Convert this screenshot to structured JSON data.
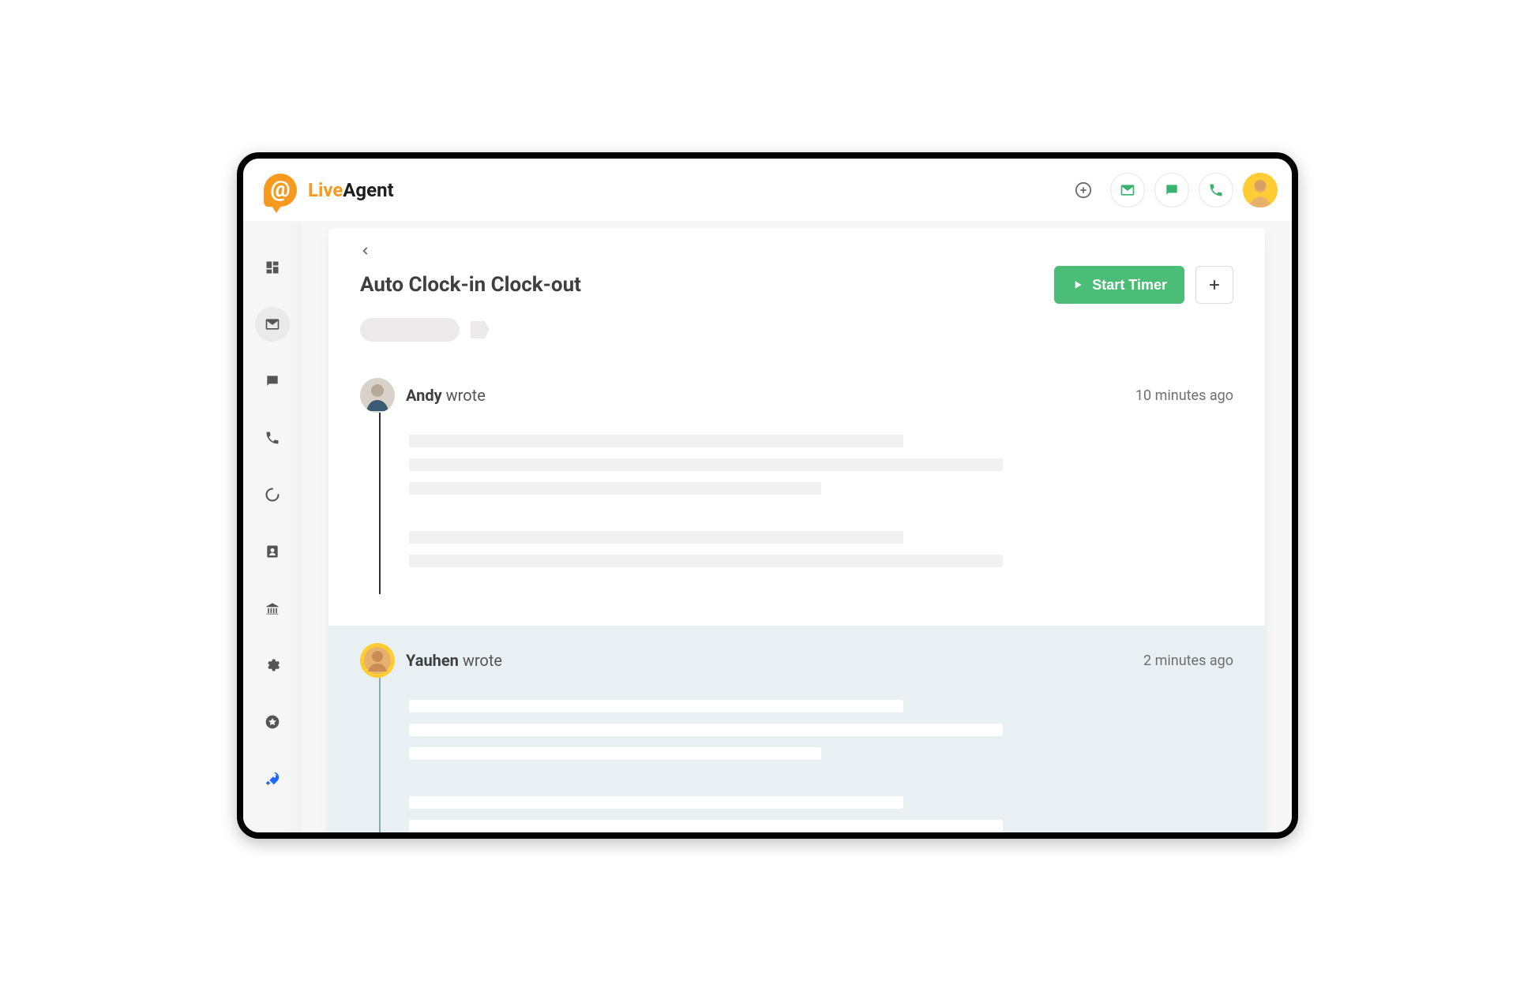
{
  "brand": {
    "part1": "Live",
    "part2": "Agent",
    "glyph": "@"
  },
  "topbar": {
    "add_icon": "plus-circle",
    "mail_icon": "mail",
    "chat_icon": "chat",
    "phone_icon": "phone"
  },
  "sidebar": {
    "items": [
      {
        "key": "dashboard",
        "icon": "dashboard",
        "active": false
      },
      {
        "key": "mail",
        "icon": "mail",
        "active": true
      },
      {
        "key": "chat",
        "icon": "chat",
        "active": false
      },
      {
        "key": "phone",
        "icon": "phone",
        "active": false
      },
      {
        "key": "loading",
        "icon": "spinner",
        "active": false
      },
      {
        "key": "contacts",
        "icon": "contact",
        "active": false
      },
      {
        "key": "kb",
        "icon": "building",
        "active": false
      },
      {
        "key": "settings",
        "icon": "gear",
        "active": false
      },
      {
        "key": "starred",
        "icon": "star",
        "active": false
      },
      {
        "key": "rocket",
        "icon": "rocket",
        "active": false
      }
    ]
  },
  "ticket": {
    "title": "Auto Clock-in Clock-out",
    "timer_label": "Start Timer",
    "add_label": "+"
  },
  "messages": [
    {
      "author": "Andy",
      "verb": "wrote",
      "time": "10 minutes ago",
      "tone": "white",
      "avatar_ring": false,
      "placeholders": [
        60,
        72,
        50,
        0,
        60,
        72
      ]
    },
    {
      "author": "Yauhen",
      "verb": "wrote",
      "time": "2 minutes ago",
      "tone": "blue",
      "avatar_ring": true,
      "placeholders": [
        60,
        72,
        50,
        0,
        60,
        72
      ]
    }
  ]
}
